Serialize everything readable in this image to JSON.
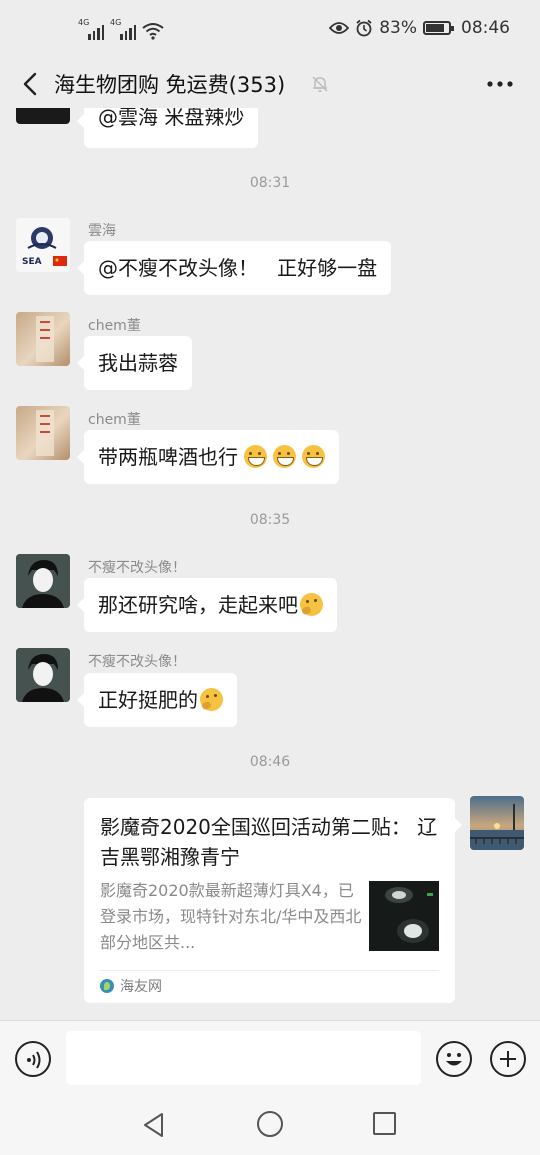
{
  "status_bar": {
    "signal_1_tag": "4G",
    "signal_2_tag": "4G",
    "battery_percent": "83%",
    "battery_level": 0.83,
    "time": "08:46"
  },
  "header": {
    "title": "海生物团购  免运费(353)",
    "mute_icon": "bell-muted-icon",
    "more_icon": "more-dots-icon",
    "back_icon": "chevron-left-icon"
  },
  "chat": {
    "partial_message": "@雲海  米盘辣炒",
    "timestamps": [
      "08:31",
      "08:35",
      "08:46"
    ],
    "messages": [
      {
        "sender": "雲海",
        "text": "@不瘦不改头像！   正好够一盘"
      },
      {
        "sender": "chem董",
        "text": "我出蒜蓉"
      },
      {
        "sender": "chem董",
        "text": "带两瓶啤酒也行"
      },
      {
        "sender": "不瘦不改头像！",
        "text": "那还研究啥，走起来吧"
      },
      {
        "sender": "不瘦不改头像！",
        "text": "正好挺肥的"
      }
    ],
    "link_card": {
      "title": "影魔奇2020全国巡回活动第二贴： 辽吉黑鄂湘豫青宁",
      "description": "影魔奇2020款最新超薄灯具X4，已登录市场，现特针对东北/华中及西北部分地区共...",
      "source": "海友网"
    }
  },
  "input_bar": {
    "voice_icon": "voice-icon",
    "emoji_icon": "emoji-icon",
    "plus_icon": "plus-icon",
    "placeholder": ""
  },
  "nav_bar": {
    "back_icon": "triangle-back-icon",
    "home_icon": "circle-home-icon",
    "recent_icon": "square-recent-icon"
  }
}
